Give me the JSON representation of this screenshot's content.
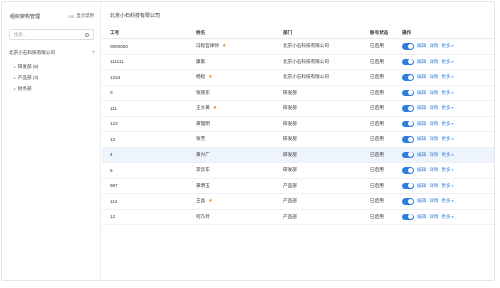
{
  "sidebar": {
    "title": "组织架构管理",
    "toggle_label": "显示禁用",
    "search_placeholder": "搜索...",
    "company": "北京小石科技有限公司",
    "tree": [
      {
        "label": "研发部 (8)"
      },
      {
        "label": "产品部 (3)"
      },
      {
        "label": "财务部"
      }
    ]
  },
  "main": {
    "title": "北京小石科技有限公司",
    "columns": [
      "工号",
      "姓名",
      "部门",
      "账号状态",
      "操作"
    ],
    "ops": {
      "edit": "编辑",
      "detail": "详情",
      "more": "更多"
    },
    "rows": [
      {
        "id": "0000000",
        "name": "冯程哲律师",
        "star": true,
        "dept": "北京小石科技有限公司",
        "status": "已启用"
      },
      {
        "id": "111111",
        "name": "康家",
        "star": false,
        "dept": "北京小石科技有限公司",
        "status": "已启用"
      },
      {
        "id": "1234",
        "name": "杨程",
        "star": true,
        "dept": "北京小石科技有限公司",
        "status": "已启用"
      },
      {
        "id": "0",
        "name": "张晓东",
        "star": false,
        "dept": "研发部",
        "status": "已启用"
      },
      {
        "id": "111",
        "name": "王大黄",
        "star": true,
        "dept": "研发部",
        "status": "已启用"
      },
      {
        "id": "123",
        "name": "黄理明",
        "star": false,
        "dept": "研发部",
        "status": "已启用"
      },
      {
        "id": "13",
        "name": "张芳",
        "star": false,
        "dept": "研发部",
        "status": "已启用"
      },
      {
        "id": "4",
        "name": "黄兴广",
        "star": false,
        "dept": "研发部",
        "status": "已启用"
      },
      {
        "id": "5",
        "name": "李云东",
        "star": false,
        "dept": "研发部",
        "status": "已启用"
      },
      {
        "id": "987",
        "name": "黄明玉",
        "star": false,
        "dept": "产品部",
        "status": "已启用"
      },
      {
        "id": "114",
        "name": "王晶",
        "star": true,
        "dept": "产品部",
        "status": "已启用"
      },
      {
        "id": "12",
        "name": "何乃玲",
        "star": false,
        "dept": "产品部",
        "status": "已启用"
      }
    ]
  }
}
